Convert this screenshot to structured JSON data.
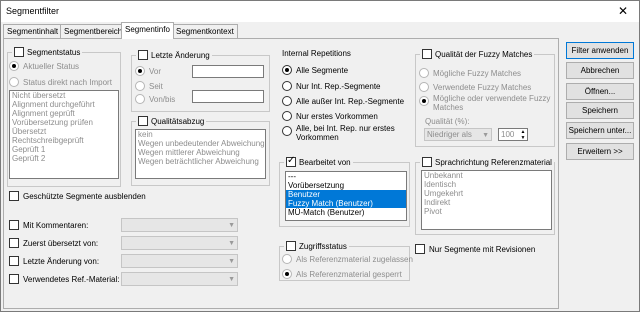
{
  "window": {
    "title": "Segmentfilter",
    "close_glyph": "✕"
  },
  "tabs": [
    {
      "label": "Segmentinhalt"
    },
    {
      "label": "Segmentbereich"
    },
    {
      "label": "Segmentinfo"
    },
    {
      "label": "Segmentkontext"
    }
  ],
  "segmentstatus": {
    "label": "Segmentstatus",
    "checked": false,
    "option_current": "Aktueller Status",
    "option_direct": "Status direkt nach Import",
    "items": [
      "Nicht übersetzt",
      "Alignment durchgeführt",
      "Alignment geprüft",
      "Vorübersetzung prüfen",
      "Übersetzt",
      "Rechtschreibgeprüft",
      "Geprüft 1",
      "Geprüft 2"
    ]
  },
  "letzte_aenderung": {
    "label": "Letzte Änderung",
    "options": [
      "Vor",
      "Seit",
      "Von/bis"
    ]
  },
  "qualitaetsabzug": {
    "label": "Qualitätsabzug",
    "items": [
      "kein",
      "Wegen unbedeutender Abweichung",
      "Wegen mittlerer Abweichung",
      "Wegen beträchtlicher Abweichung"
    ]
  },
  "internal_repetitions": {
    "label": "Internal Repetitions",
    "options": [
      "Alle Segmente",
      "Nur Int. Rep.-Segmente",
      "Alle außer Int. Rep.-Segmente",
      "Nur erstes Vorkommen",
      "Alle, bei Int. Rep. nur erstes Vorkommen"
    ]
  },
  "fuzzy": {
    "label": "Qualität der Fuzzy Matches",
    "options": [
      "Mögliche Fuzzy Matches",
      "Verwendete Fuzzy Matches",
      "Mögliche oder verwendete Fuzzy Matches"
    ],
    "quality_label": "Qualität (%):",
    "quality_combo": "Niedriger als",
    "quality_value": "100"
  },
  "bearbeitet_von": {
    "label": "Bearbeitet von",
    "items": [
      "---",
      "Vorübersetzung",
      "Benutzer",
      "Fuzzy Match (Benutzer)",
      "MÜ-Match (Benutzer)"
    ]
  },
  "sprachrichtung": {
    "label": "Sprachrichtung Referenzmaterial",
    "items": [
      "Unbekannt",
      "Identisch",
      "Umgekehrt",
      "Indirekt",
      "Pivot"
    ]
  },
  "zugriffsstatus": {
    "label": "Zugriffsstatus",
    "options": [
      "Als Referenzmaterial zugelassen",
      "Als Referenzmaterial gesperrt"
    ]
  },
  "revisions_label": "Nur Segmente mit Revisionen",
  "protected_label": "Geschützte Segmente ausblenden",
  "filters": [
    {
      "label": "Mit Kommentaren:"
    },
    {
      "label": "Zuerst übersetzt von:"
    },
    {
      "label": "Letzte Änderung von:"
    },
    {
      "label": "Verwendetes Ref.-Material:"
    }
  ],
  "buttons": {
    "apply": "Filter anwenden",
    "cancel": "Abbrechen",
    "open": "Öffnen...",
    "save": "Speichern",
    "save_as": "Speichern unter...",
    "extended": "Erweitern >>"
  }
}
